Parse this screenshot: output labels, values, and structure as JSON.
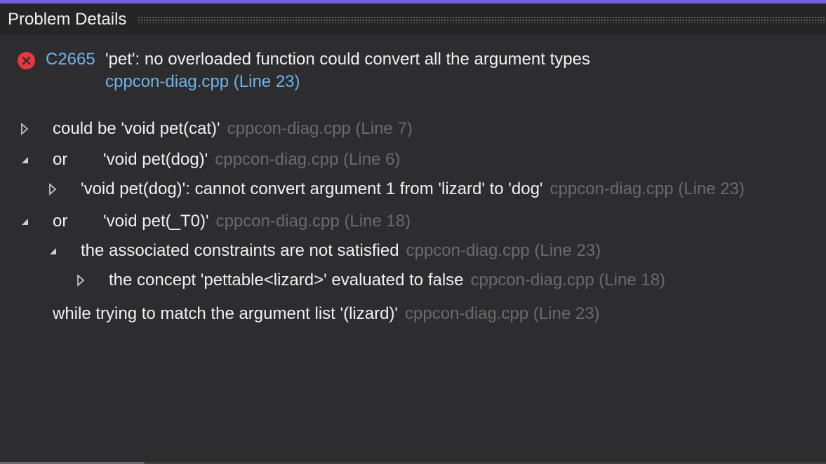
{
  "panel": {
    "title": "Problem Details"
  },
  "error": {
    "icon": "error-circle-icon",
    "code": "C2665",
    "message": "'pet': no overloaded function could convert all the argument types",
    "location": "cppcon-diag.cpp (Line 23)"
  },
  "details": [
    {
      "expander": "collapsed",
      "prefix": "",
      "text": "could be 'void pet(cat)'",
      "location": "cppcon-diag.cpp (Line 7)"
    },
    {
      "expander": "expanded",
      "prefix": "or",
      "text": "'void pet(dog)'",
      "location": "cppcon-diag.cpp (Line 6)"
    },
    {
      "expander": "collapsed",
      "prefix": "",
      "text": "'void pet(dog)': cannot convert argument 1 from 'lizard' to 'dog'",
      "location": "cppcon-diag.cpp (Line 23)"
    },
    {
      "expander": "expanded",
      "prefix": "or",
      "text": "'void pet(_T0)'",
      "location": "cppcon-diag.cpp (Line 18)"
    },
    {
      "expander": "expanded",
      "prefix": "",
      "text": "the associated constraints are not satisfied",
      "location": "cppcon-diag.cpp (Line 23)"
    },
    {
      "expander": "collapsed",
      "prefix": "",
      "text": "the concept 'pettable<lizard>' evaluated to false",
      "location": "cppcon-diag.cpp (Line 18)"
    },
    {
      "expander": "none",
      "prefix": "",
      "text": "while trying to match the argument list '(lizard)'",
      "location": "cppcon-diag.cpp (Line 23)"
    }
  ],
  "colors": {
    "accent": "#7160e8",
    "error": "#e8383d",
    "link": "#6fb3e6",
    "dim_location": "#6b6b6b"
  }
}
